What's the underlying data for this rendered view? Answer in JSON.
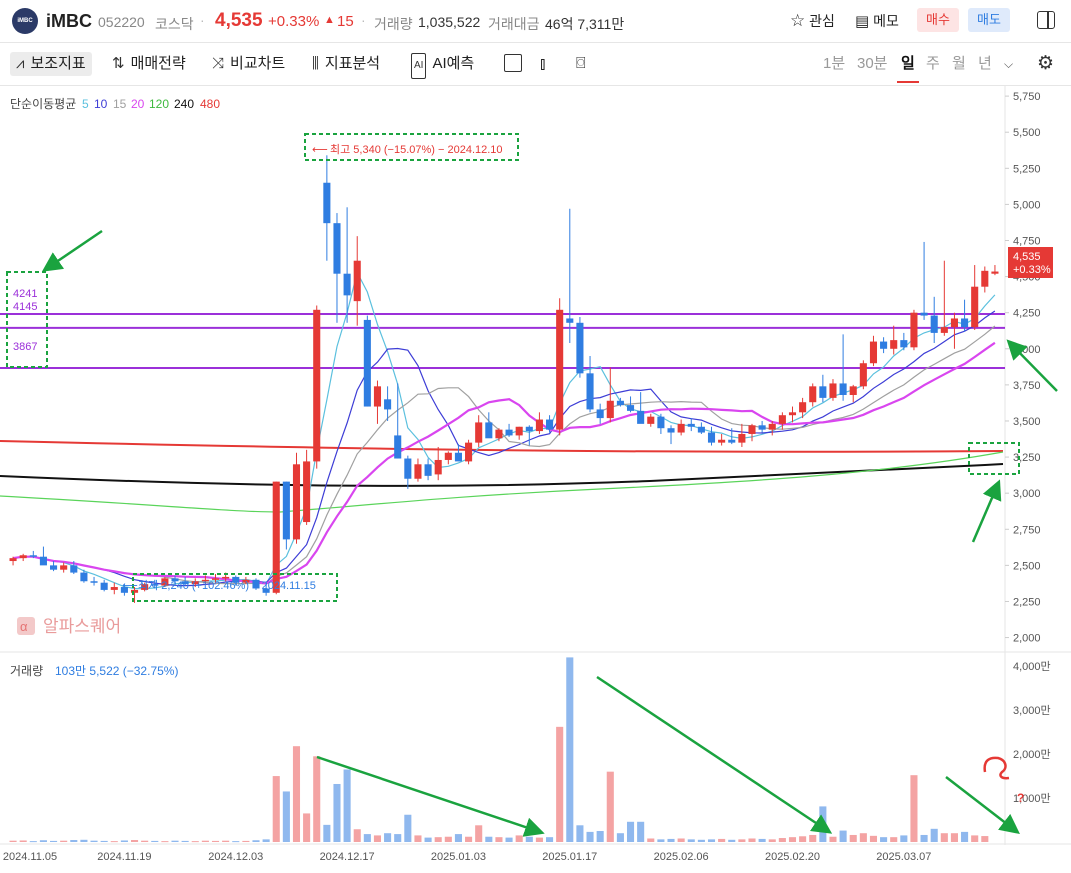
{
  "header": {
    "logo_text": "iMBC",
    "stock_name": "iMBC",
    "code": "052220",
    "market": "코스닥",
    "price": "4,535",
    "change_pct": "+0.33%",
    "change_abs": "15",
    "volume_label": "거래량",
    "volume_value": "1,035,522",
    "amount_label": "거래대금",
    "amount_value": "46억 7,311만",
    "watch_label": "관심",
    "memo_label": "메모",
    "buy_label": "매수",
    "sell_label": "매도"
  },
  "toolbar": {
    "indicators": "보조지표",
    "strategy": "매매전략",
    "compare": "비교차트",
    "analysis": "지표분석",
    "ai": "AI예측",
    "periods": [
      "1분",
      "30분",
      "일",
      "주",
      "월",
      "년"
    ],
    "active_period": "일"
  },
  "colors": {
    "up": "#e53935",
    "down": "#2f7de1",
    "ma5": "#5bc0de",
    "ma10": "#3d3dd6",
    "ma15": "#a0a0a0",
    "ma20": "#d946ef",
    "ma120": "#5ad45a",
    "ma240": "#111111",
    "ma480": "#e53935",
    "level": "#9b30d9",
    "annotation": "#1aa33f",
    "vol_up": "#f4a3a3",
    "vol_down": "#8fb8ee"
  },
  "chart_data": [
    {
      "type": "candlestick",
      "legend": {
        "title": "단순이동평균",
        "periods": [
          "5",
          "10",
          "15",
          "20",
          "120",
          "240",
          "480"
        ]
      },
      "y_ticks": [
        "5,750",
        "5,500",
        "5,250",
        "5,000",
        "4,750",
        "4,500",
        "4,250",
        "4,000",
        "3,750",
        "3,500",
        "3,250",
        "3,000",
        "2,750",
        "2,500",
        "2,250",
        "2,000"
      ],
      "ylim": [
        1900,
        5820
      ],
      "x_ticks": [
        "2024.11.05",
        "2024.11.19",
        "2024.12.03",
        "2024.12.17",
        "2025.01.03",
        "2025.01.17",
        "2025.02.06",
        "2025.02.20",
        "2025.03.07"
      ],
      "price_badge": {
        "price": "4,535",
        "change": "+0.33%"
      },
      "high_label": "최고 5,340 (−15.07%) − 2024.12.10",
      "low_label": "최저 2,240 (+102.46%) − 2024.11.15",
      "levels": [
        {
          "value": 4241,
          "label": "4241"
        },
        {
          "value": 4145,
          "label": "4145"
        },
        {
          "value": 3867,
          "label": "3867"
        }
      ],
      "watermark": "알파스퀘어",
      "candles": [
        [
          2530,
          2560,
          2500,
          2550
        ],
        [
          2550,
          2580,
          2530,
          2570
        ],
        [
          2570,
          2600,
          2550,
          2560
        ],
        [
          2560,
          2630,
          2520,
          2500
        ],
        [
          2500,
          2530,
          2460,
          2470
        ],
        [
          2470,
          2520,
          2450,
          2500
        ],
        [
          2500,
          2530,
          2440,
          2450
        ],
        [
          2450,
          2470,
          2380,
          2390
        ],
        [
          2390,
          2420,
          2360,
          2380
        ],
        [
          2380,
          2400,
          2320,
          2330
        ],
        [
          2330,
          2380,
          2300,
          2350
        ],
        [
          2350,
          2370,
          2290,
          2310
        ],
        [
          2310,
          2350,
          2240,
          2330
        ],
        [
          2330,
          2380,
          2320,
          2370
        ],
        [
          2370,
          2400,
          2340,
          2360
        ],
        [
          2360,
          2420,
          2350,
          2410
        ],
        [
          2410,
          2430,
          2370,
          2390
        ],
        [
          2390,
          2420,
          2360,
          2370
        ],
        [
          2370,
          2410,
          2350,
          2390
        ],
        [
          2390,
          2430,
          2370,
          2400
        ],
        [
          2400,
          2440,
          2380,
          2410
        ],
        [
          2410,
          2450,
          2390,
          2420
        ],
        [
          2420,
          2430,
          2360,
          2380
        ],
        [
          2380,
          2420,
          2370,
          2400
        ],
        [
          2400,
          2410,
          2330,
          2340
        ],
        [
          2340,
          2380,
          2290,
          2310
        ],
        [
          2310,
          3080,
          2300,
          3080
        ],
        [
          3080,
          3080,
          2610,
          2680
        ],
        [
          2680,
          3280,
          2650,
          3200
        ],
        [
          2800,
          3300,
          2780,
          3220
        ],
        [
          3220,
          4300,
          3170,
          4270
        ],
        [
          5150,
          5340,
          4610,
          4870
        ],
        [
          4870,
          4940,
          4180,
          4520
        ],
        [
          4520,
          4980,
          4180,
          4370
        ],
        [
          4330,
          4780,
          4160,
          4610
        ],
        [
          4200,
          4230,
          3600,
          3600
        ],
        [
          3600,
          3780,
          3480,
          3740
        ],
        [
          3650,
          3740,
          3500,
          3580
        ],
        [
          3400,
          3760,
          3240,
          3240
        ],
        [
          3240,
          3260,
          3030,
          3100
        ],
        [
          3100,
          3240,
          3080,
          3200
        ],
        [
          3200,
          3240,
          3090,
          3120
        ],
        [
          3130,
          3320,
          3090,
          3230
        ],
        [
          3230,
          3290,
          3200,
          3280
        ],
        [
          3280,
          3340,
          3220,
          3220
        ],
        [
          3220,
          3370,
          3200,
          3350
        ],
        [
          3350,
          3540,
          3320,
          3490
        ],
        [
          3490,
          3560,
          3450,
          3380
        ],
        [
          3380,
          3450,
          3360,
          3440
        ],
        [
          3440,
          3480,
          3390,
          3400
        ],
        [
          3400,
          3460,
          3370,
          3460
        ],
        [
          3460,
          3470,
          3330,
          3430
        ],
        [
          3430,
          3560,
          3410,
          3510
        ],
        [
          3510,
          3540,
          3420,
          3440
        ],
        [
          3440,
          4350,
          3400,
          4270
        ],
        [
          4210,
          4970,
          4040,
          4180
        ],
        [
          4180,
          4220,
          3800,
          3830
        ],
        [
          3830,
          3950,
          3560,
          3580
        ],
        [
          3580,
          3620,
          3480,
          3520
        ],
        [
          3520,
          3870,
          3490,
          3640
        ],
        [
          3640,
          3660,
          3600,
          3610
        ],
        [
          3610,
          3670,
          3560,
          3570
        ],
        [
          3570,
          3700,
          3520,
          3480
        ],
        [
          3480,
          3550,
          3460,
          3530
        ],
        [
          3530,
          3550,
          3410,
          3450
        ],
        [
          3450,
          3470,
          3340,
          3420
        ],
        [
          3420,
          3510,
          3400,
          3480
        ],
        [
          3480,
          3520,
          3430,
          3460
        ],
        [
          3460,
          3490,
          3410,
          3420
        ],
        [
          3420,
          3460,
          3330,
          3350
        ],
        [
          3350,
          3410,
          3330,
          3370
        ],
        [
          3370,
          3450,
          3340,
          3350
        ],
        [
          3350,
          3480,
          3320,
          3410
        ],
        [
          3410,
          3480,
          3360,
          3470
        ],
        [
          3470,
          3500,
          3420,
          3440
        ],
        [
          3440,
          3500,
          3400,
          3480
        ],
        [
          3480,
          3560,
          3440,
          3540
        ],
        [
          3540,
          3600,
          3490,
          3560
        ],
        [
          3560,
          3660,
          3520,
          3630
        ],
        [
          3630,
          3760,
          3600,
          3740
        ],
        [
          3740,
          3820,
          3630,
          3660
        ],
        [
          3660,
          3790,
          3640,
          3760
        ],
        [
          3760,
          4100,
          3640,
          3680
        ],
        [
          3680,
          3750,
          3630,
          3740
        ],
        [
          3740,
          3920,
          3720,
          3900
        ],
        [
          3900,
          4090,
          3880,
          4050
        ],
        [
          4050,
          4080,
          3970,
          4000
        ],
        [
          4000,
          4160,
          3960,
          4060
        ],
        [
          4060,
          4110,
          3990,
          4010
        ],
        [
          4010,
          4270,
          3990,
          4250
        ],
        [
          4250,
          4740,
          4200,
          4230
        ],
        [
          4230,
          4360,
          4040,
          4110
        ],
        [
          4110,
          4610,
          4090,
          4150
        ],
        [
          4150,
          4250,
          4000,
          4210
        ],
        [
          4210,
          4340,
          4120,
          4150
        ],
        [
          4150,
          4580,
          4130,
          4430
        ],
        [
          4430,
          4570,
          4390,
          4540
        ],
        [
          4520,
          4580,
          4510,
          4535
        ]
      ]
    },
    {
      "type": "bar",
      "title": "거래량",
      "summary": "103만 5,522 (−32.75%)",
      "y_ticks": [
        "4,000만",
        "3,000만",
        "2,000만",
        "1,000만"
      ],
      "ylim": [
        0,
        4300
      ],
      "unit": "만",
      "values": [
        30,
        35,
        20,
        40,
        25,
        30,
        45,
        50,
        30,
        25,
        20,
        35,
        45,
        30,
        25,
        20,
        30,
        25,
        20,
        30,
        25,
        30,
        20,
        25,
        40,
        60,
        1500,
        1150,
        2180,
        650,
        1950,
        390,
        1320,
        1650,
        290,
        180,
        150,
        200,
        180,
        620,
        150,
        100,
        110,
        120,
        180,
        120,
        380,
        120,
        110,
        100,
        150,
        120,
        100,
        110,
        2620,
        4200,
        380,
        230,
        250,
        1600,
        200,
        460,
        460,
        80,
        60,
        70,
        80,
        60,
        50,
        60,
        70,
        50,
        60,
        80,
        70,
        60,
        90,
        110,
        130,
        160,
        810,
        120,
        260,
        160,
        200,
        140,
        110,
        110,
        150,
        1520,
        160,
        300,
        200,
        200,
        230,
        150,
        135
      ]
    }
  ],
  "annotations": {
    "right_scribble": "?"
  }
}
